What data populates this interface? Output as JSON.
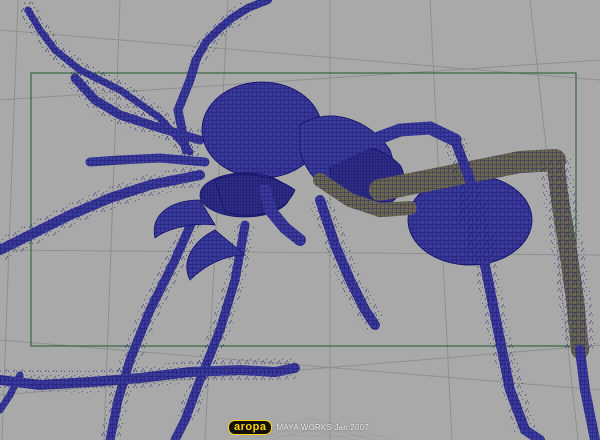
{
  "viewport": {
    "background_color": "#a9a9a9",
    "wireframe_color": "#1c1a78",
    "resolution_gate_color": "#1f5a2a",
    "grid_color": "#8f8f8f",
    "subject": "ant-wireframe-model"
  },
  "watermark": {
    "logo_text": "aropa",
    "caption": "MAYA WORKS Jan.2007"
  }
}
